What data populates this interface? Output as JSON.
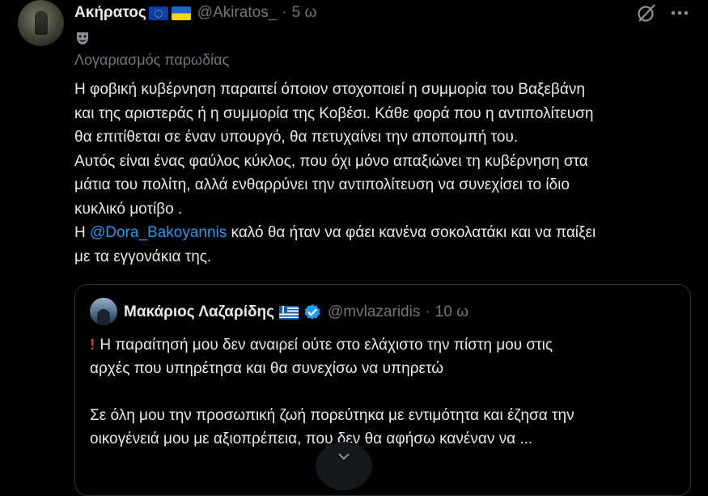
{
  "tweet": {
    "author_name": "Ακήρατος",
    "author_handle": "@Akiratos_",
    "separator": "·",
    "time": "5 ω",
    "parody_label": "Λογαριασμός παρωδίας",
    "icons": [
      "avatar",
      "eu-flag-icon",
      "ukraine-flag-icon",
      "grok-icon",
      "more-icon",
      "theater-mask-icon"
    ],
    "lines": [
      "Η φοβική κυβέρνηση παραιτεί όποιον στοχοποιεί η συμμορία του Βαξεβάνη",
      "και της αριστεράς ή η συμμορία της Κοβέσι. Κάθε φορά που η αντιπολίτευση",
      "θα επιτίθεται σε έναν υπουργό, θα πετυχαίνει την αποπομπή του.",
      "Αυτός είναι ένας φαύλος κύκλος, που όχι μόνο απαξιώνει τη κυβέρνηση στα",
      "μάτια του πολίτη, αλλά ενθαρρύνει την αντιπολίτευση να συνεχίσει το ίδιο",
      "κυκλικό μοτίβο ."
    ],
    "mention_prefix": "Η ",
    "mention": "@Dora_Bakoyannis",
    "mention_suffix": " καλό θα ήταν να φάει κανένα σοκολατάκι και να παίξει",
    "last_line": "με τα εγγονάκια της."
  },
  "quote": {
    "author_name": "Μακάριος Λαζαρίδης",
    "author_handle": "@mvlazaridis",
    "separator": "·",
    "time": "10 ω",
    "icons": [
      "greece-flag-icon",
      "verified-icon",
      "exclamation-icon"
    ],
    "line1": "Η παραίτησή μου δεν αναιρεί ούτε στο ελάχιστο την πίστη μου στις",
    "line2": "αρχές που υπηρέτησα και θα συνεχίσω να υπηρετώ",
    "line3": "Σε όλη μου την προσωπική ζωή πορεύτηκα με εντιμότητα και έζησα την",
    "line4": "οικογένειά μου με αξιοπρέπεια, που δεν θα αφήσω κανέναν να ..."
  },
  "colors": {
    "background": "#000000",
    "text": "#e7e9ea",
    "muted": "#71767b",
    "link": "#1d9bf0",
    "border": "#2f3336"
  }
}
